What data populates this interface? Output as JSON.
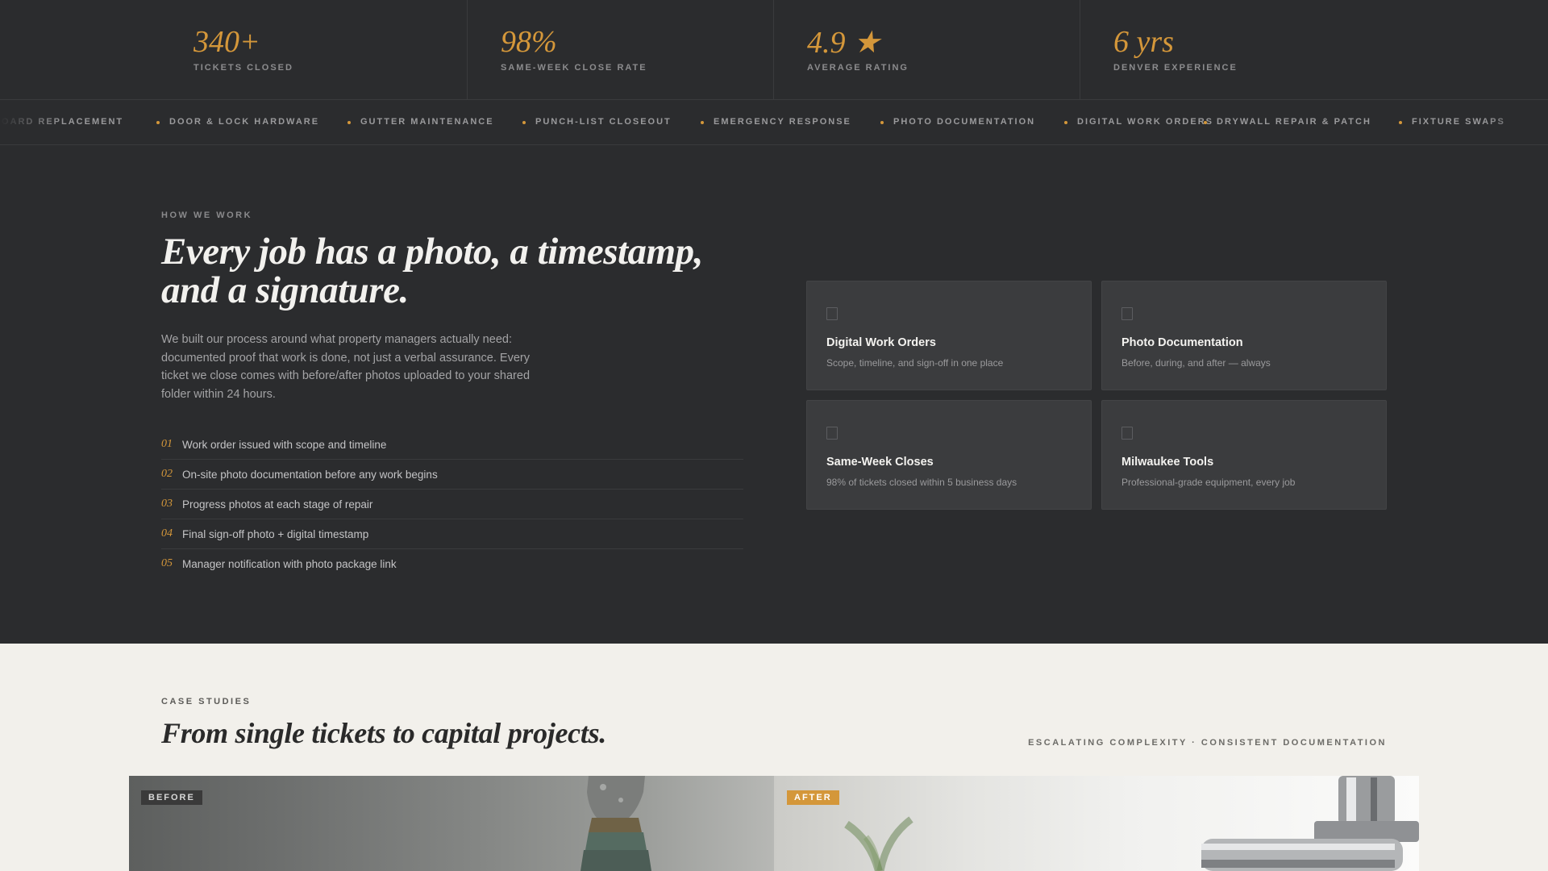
{
  "stats": [
    {
      "value": "340+",
      "label": "TICKETS CLOSED"
    },
    {
      "value": "98%",
      "label": "SAME-WEEK CLOSE RATE"
    },
    {
      "value": "4.9 ★",
      "label": "AVERAGE RATING"
    },
    {
      "value": "6 yrs",
      "label": "DENVER EXPERIENCE"
    }
  ],
  "ticker": [
    "BOARD REPLACEMENT",
    "DOOR & LOCK HARDWARE",
    "GUTTER MAINTENANCE",
    "PUNCH-LIST CLOSEOUT",
    "EMERGENCY RESPONSE",
    "PHOTO DOCUMENTATION",
    "DIGITAL WORK ORDERS",
    "DRYWALL REPAIR & PATCH",
    "FIXTURE SWAPS"
  ],
  "how_we_work": {
    "eyebrow": "HOW WE WORK",
    "title": "Every job has a photo, a timestamp, and a signature.",
    "body": "We built our process around what property managers actually need: documented proof that work is done, not just a verbal assurance. Every ticket we close comes with before/after photos uploaded to your shared folder within 24 hours.",
    "steps": [
      {
        "num": "01",
        "text": "Work order issued with scope and timeline"
      },
      {
        "num": "02",
        "text": "On-site photo documentation before any work begins"
      },
      {
        "num": "03",
        "text": "Progress photos at each stage of repair"
      },
      {
        "num": "04",
        "text": "Final sign-off photo + digital timestamp"
      },
      {
        "num": "05",
        "text": "Manager notification with photo package link"
      }
    ],
    "cards": [
      {
        "title": "Digital Work Orders",
        "desc": "Scope, timeline, and sign-off in one place"
      },
      {
        "title": "Photo Documentation",
        "desc": "Before, during, and after — always"
      },
      {
        "title": "Same-Week Closes",
        "desc": "98% of tickets closed within 5 business days"
      },
      {
        "title": "Milwaukee Tools",
        "desc": "Professional-grade equipment, every job"
      }
    ]
  },
  "case_studies": {
    "eyebrow": "CASE STUDIES",
    "title": "From single tickets to capital projects.",
    "tagline": "ESCALATING COMPLEXITY · CONSISTENT DOCUMENTATION",
    "before_label": "BEFORE",
    "after_label": "AFTER"
  },
  "colors": {
    "accent": "#d4973a",
    "dark_bg": "#2b2c2e",
    "light_bg": "#f2f0eb"
  }
}
